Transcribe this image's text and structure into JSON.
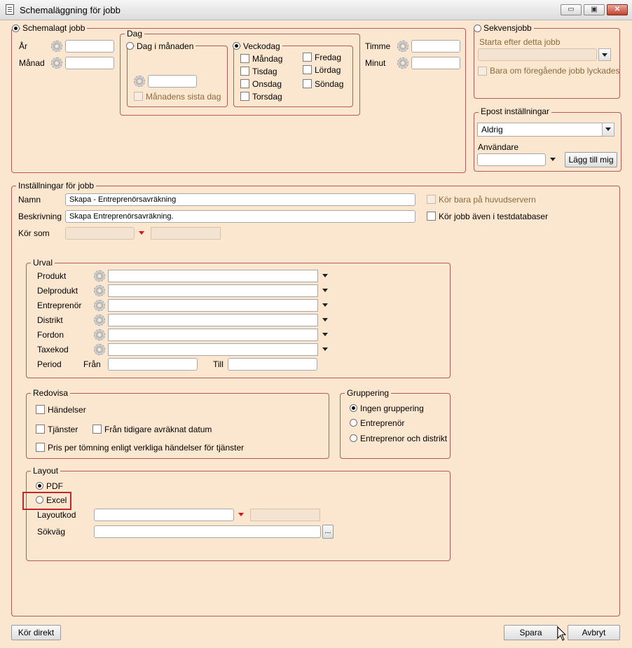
{
  "window": {
    "title": "Schemaläggning för jobb",
    "controls": {
      "minimize": "▭",
      "maximize": "▣",
      "close": "✕"
    }
  },
  "schedule": {
    "radio_label": "Schemalagt jobb",
    "year_label": "År",
    "month_label": "Månad",
    "hour_label": "Timme",
    "minute_label": "Minut",
    "day": {
      "legend": "Dag",
      "day_of_month_label": "Dag i månaden",
      "last_day_label": "Månadens sista dag",
      "weekday_label": "Veckodag",
      "weekdays": [
        "Måndag",
        "Tisdag",
        "Onsdag",
        "Torsdag",
        "Fredag",
        "Lördag",
        "Söndag"
      ]
    }
  },
  "sequence": {
    "radio_label": "Sekvensjobb",
    "start_after_label": "Starta efter detta jobb",
    "only_if_success_label": "Bara om föregående jobb lyckades"
  },
  "email": {
    "legend": "Epost inställningar",
    "frequency_value": "Aldrig",
    "users_label": "Användare",
    "add_me_button": "Lägg till mig"
  },
  "job_settings": {
    "legend": "Inställningar för jobb",
    "name_label": "Namn",
    "name_value": "Skapa - Entreprenörsavräkning",
    "description_label": "Beskrivning",
    "description_value": "Skapa Entreprenörsavräkning.",
    "run_as_label": "Kör som",
    "main_server_only_label": "Kör bara på huvudservern",
    "run_in_test_label": "Kör jobb även i testdatabaser"
  },
  "selection": {
    "legend": "Urval",
    "fields": [
      "Produkt",
      "Delprodukt",
      "Entreprenör",
      "Distrikt",
      "Fordon",
      "Taxekod"
    ],
    "period_label": "Period",
    "from_label": "Från",
    "to_label": "Till"
  },
  "report": {
    "legend": "Redovisa",
    "events_label": "Händelser",
    "services_label": "Tjänster",
    "from_earlier_label": "Från tidigare avräknat datum",
    "price_per_emptying_label": "Pris per tömning enligt verkliga händelser för tjänster"
  },
  "grouping": {
    "legend": "Gruppering",
    "options": [
      "Ingen gruppering",
      "Entreprenör",
      "Entreprenor och distrikt"
    ]
  },
  "layout": {
    "legend": "Layout",
    "pdf_label": "PDF",
    "excel_label": "Excel",
    "layout_code_label": "Layoutkod",
    "path_label": "Sökväg",
    "browse_button": "..."
  },
  "footer": {
    "run_now_button": "Kör direkt",
    "save_button": "Spara",
    "cancel_button": "Avbryt"
  },
  "icons": [
    "document-icon",
    "gear-icon",
    "dropdown-arrow-icon",
    "mouse-cursor-icon"
  ],
  "colors": {
    "background": "#fbe7d0",
    "group_border": "#b45a5a",
    "highlight": "#c0292b"
  }
}
